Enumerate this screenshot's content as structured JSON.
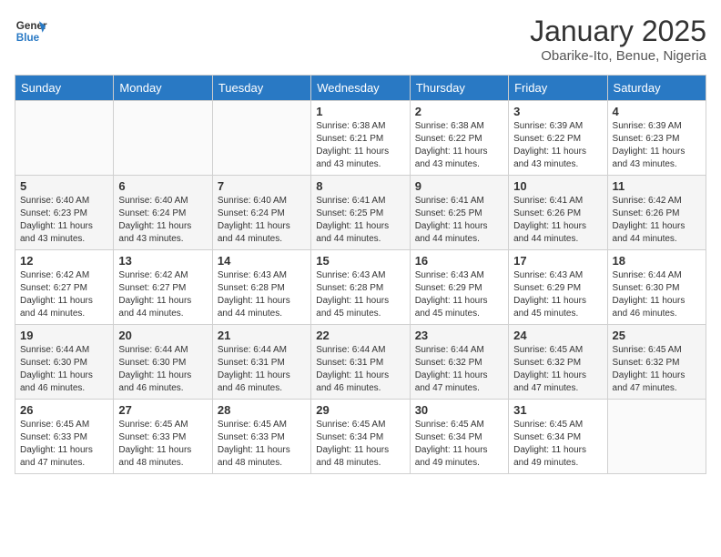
{
  "header": {
    "logo_line1": "General",
    "logo_line2": "Blue",
    "title": "January 2025",
    "subtitle": "Obarike-Ito, Benue, Nigeria"
  },
  "days_of_week": [
    "Sunday",
    "Monday",
    "Tuesday",
    "Wednesday",
    "Thursday",
    "Friday",
    "Saturday"
  ],
  "weeks": [
    [
      {
        "day": "",
        "info": ""
      },
      {
        "day": "",
        "info": ""
      },
      {
        "day": "",
        "info": ""
      },
      {
        "day": "1",
        "info": "Sunrise: 6:38 AM\nSunset: 6:21 PM\nDaylight: 11 hours and 43 minutes."
      },
      {
        "day": "2",
        "info": "Sunrise: 6:38 AM\nSunset: 6:22 PM\nDaylight: 11 hours and 43 minutes."
      },
      {
        "day": "3",
        "info": "Sunrise: 6:39 AM\nSunset: 6:22 PM\nDaylight: 11 hours and 43 minutes."
      },
      {
        "day": "4",
        "info": "Sunrise: 6:39 AM\nSunset: 6:23 PM\nDaylight: 11 hours and 43 minutes."
      }
    ],
    [
      {
        "day": "5",
        "info": "Sunrise: 6:40 AM\nSunset: 6:23 PM\nDaylight: 11 hours and 43 minutes."
      },
      {
        "day": "6",
        "info": "Sunrise: 6:40 AM\nSunset: 6:24 PM\nDaylight: 11 hours and 43 minutes."
      },
      {
        "day": "7",
        "info": "Sunrise: 6:40 AM\nSunset: 6:24 PM\nDaylight: 11 hours and 44 minutes."
      },
      {
        "day": "8",
        "info": "Sunrise: 6:41 AM\nSunset: 6:25 PM\nDaylight: 11 hours and 44 minutes."
      },
      {
        "day": "9",
        "info": "Sunrise: 6:41 AM\nSunset: 6:25 PM\nDaylight: 11 hours and 44 minutes."
      },
      {
        "day": "10",
        "info": "Sunrise: 6:41 AM\nSunset: 6:26 PM\nDaylight: 11 hours and 44 minutes."
      },
      {
        "day": "11",
        "info": "Sunrise: 6:42 AM\nSunset: 6:26 PM\nDaylight: 11 hours and 44 minutes."
      }
    ],
    [
      {
        "day": "12",
        "info": "Sunrise: 6:42 AM\nSunset: 6:27 PM\nDaylight: 11 hours and 44 minutes."
      },
      {
        "day": "13",
        "info": "Sunrise: 6:42 AM\nSunset: 6:27 PM\nDaylight: 11 hours and 44 minutes."
      },
      {
        "day": "14",
        "info": "Sunrise: 6:43 AM\nSunset: 6:28 PM\nDaylight: 11 hours and 44 minutes."
      },
      {
        "day": "15",
        "info": "Sunrise: 6:43 AM\nSunset: 6:28 PM\nDaylight: 11 hours and 45 minutes."
      },
      {
        "day": "16",
        "info": "Sunrise: 6:43 AM\nSunset: 6:29 PM\nDaylight: 11 hours and 45 minutes."
      },
      {
        "day": "17",
        "info": "Sunrise: 6:43 AM\nSunset: 6:29 PM\nDaylight: 11 hours and 45 minutes."
      },
      {
        "day": "18",
        "info": "Sunrise: 6:44 AM\nSunset: 6:30 PM\nDaylight: 11 hours and 46 minutes."
      }
    ],
    [
      {
        "day": "19",
        "info": "Sunrise: 6:44 AM\nSunset: 6:30 PM\nDaylight: 11 hours and 46 minutes."
      },
      {
        "day": "20",
        "info": "Sunrise: 6:44 AM\nSunset: 6:30 PM\nDaylight: 11 hours and 46 minutes."
      },
      {
        "day": "21",
        "info": "Sunrise: 6:44 AM\nSunset: 6:31 PM\nDaylight: 11 hours and 46 minutes."
      },
      {
        "day": "22",
        "info": "Sunrise: 6:44 AM\nSunset: 6:31 PM\nDaylight: 11 hours and 46 minutes."
      },
      {
        "day": "23",
        "info": "Sunrise: 6:44 AM\nSunset: 6:32 PM\nDaylight: 11 hours and 47 minutes."
      },
      {
        "day": "24",
        "info": "Sunrise: 6:45 AM\nSunset: 6:32 PM\nDaylight: 11 hours and 47 minutes."
      },
      {
        "day": "25",
        "info": "Sunrise: 6:45 AM\nSunset: 6:32 PM\nDaylight: 11 hours and 47 minutes."
      }
    ],
    [
      {
        "day": "26",
        "info": "Sunrise: 6:45 AM\nSunset: 6:33 PM\nDaylight: 11 hours and 47 minutes."
      },
      {
        "day": "27",
        "info": "Sunrise: 6:45 AM\nSunset: 6:33 PM\nDaylight: 11 hours and 48 minutes."
      },
      {
        "day": "28",
        "info": "Sunrise: 6:45 AM\nSunset: 6:33 PM\nDaylight: 11 hours and 48 minutes."
      },
      {
        "day": "29",
        "info": "Sunrise: 6:45 AM\nSunset: 6:34 PM\nDaylight: 11 hours and 48 minutes."
      },
      {
        "day": "30",
        "info": "Sunrise: 6:45 AM\nSunset: 6:34 PM\nDaylight: 11 hours and 49 minutes."
      },
      {
        "day": "31",
        "info": "Sunrise: 6:45 AM\nSunset: 6:34 PM\nDaylight: 11 hours and 49 minutes."
      },
      {
        "day": "",
        "info": ""
      }
    ]
  ]
}
